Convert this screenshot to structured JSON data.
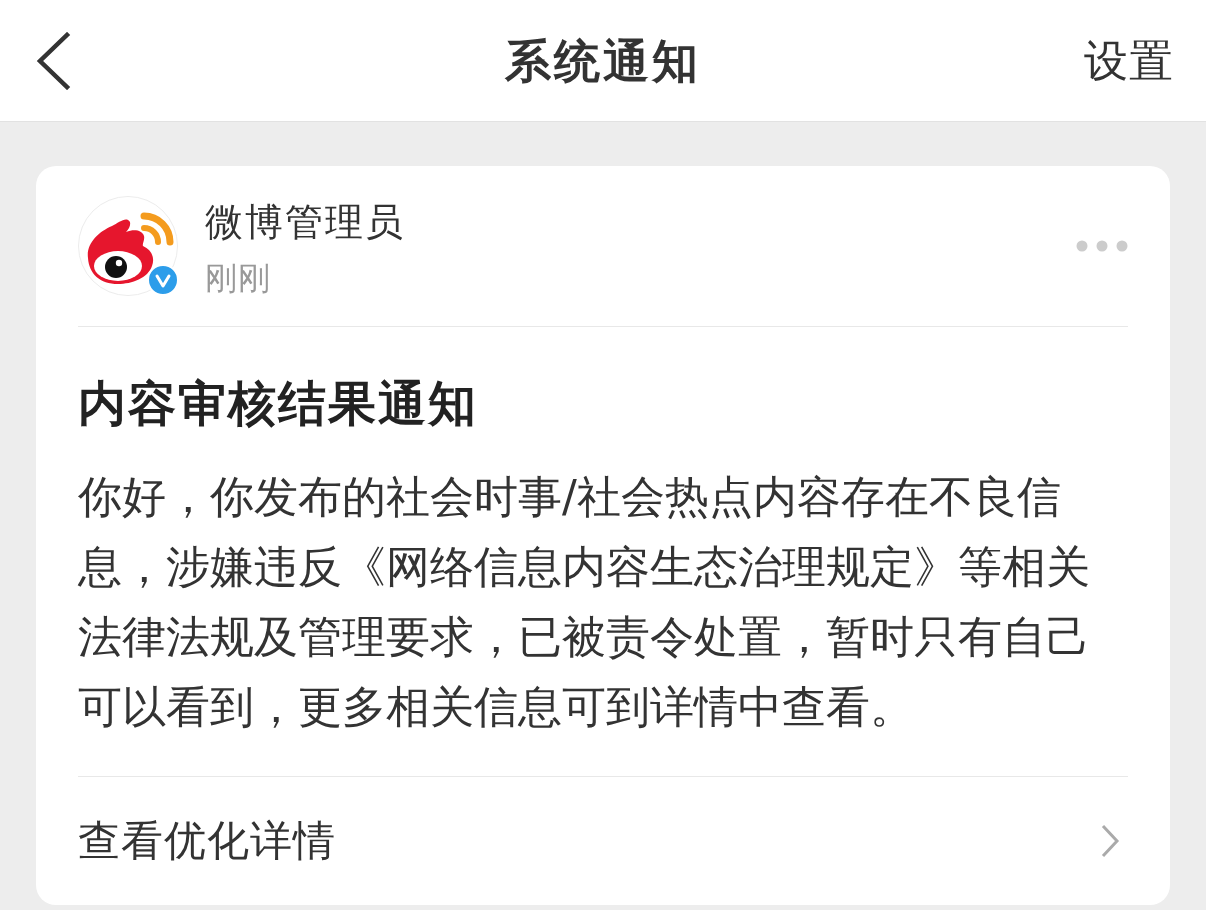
{
  "header": {
    "title": "系统通知",
    "action": "设置"
  },
  "notification": {
    "sender": "微博管理员",
    "verified": true,
    "time": "刚刚",
    "title": "内容审核结果通知",
    "body": "你好，你发布的社会时事/社会热点内容存在不良信息，涉嫌违反《网络信息内容生态治理规定》等相关法律法规及管理要求，已被责令处置，暂时只有自己可以看到，更多相关信息可到详情中查看。",
    "link": "查看优化详情"
  }
}
